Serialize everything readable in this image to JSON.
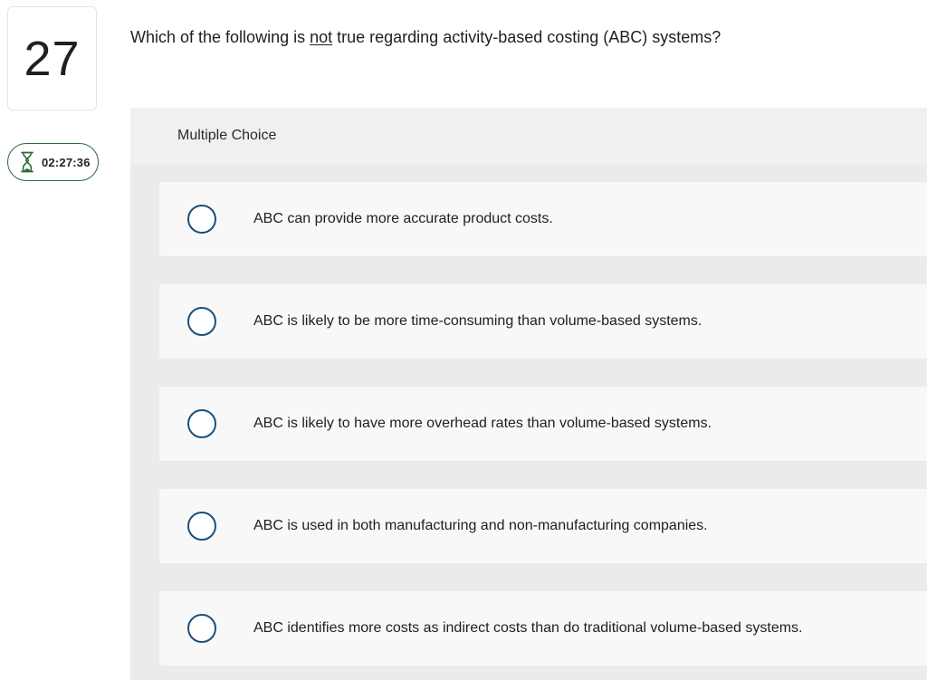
{
  "question": {
    "number": "27",
    "text_before": "Which of the following is ",
    "text_underlined": "not",
    "text_after": " true regarding activity-based costing (ABC) systems?"
  },
  "timer": {
    "icon": "hourglass-icon",
    "value": "02:27:36",
    "accent_color": "#2d6a35"
  },
  "answer_panel": {
    "title": "Multiple Choice",
    "choices": [
      {
        "label": "ABC can provide more accurate product costs."
      },
      {
        "label": "ABC is likely to be more time-consuming than volume-based systems."
      },
      {
        "label": "ABC is likely to have more overhead rates than volume-based systems."
      },
      {
        "label": "ABC is used in both manufacturing and non-manufacturing companies."
      },
      {
        "label": "ABC identifies more costs as indirect costs than do traditional volume-based systems."
      }
    ]
  }
}
